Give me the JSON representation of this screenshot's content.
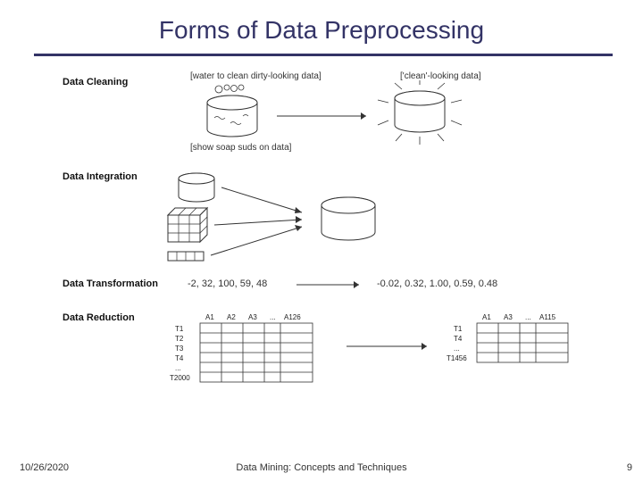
{
  "title": "Forms of Data Preprocessing",
  "sections": {
    "cleaning": "Data Cleaning",
    "integration": "Data Integration",
    "transformation": "Data Transformation",
    "reduction": "Data Reduction"
  },
  "captions": {
    "dirty": "[water to clean dirty-looking data]",
    "clean": "['clean'-looking data]",
    "suds": "[show soap suds on data]"
  },
  "transformation": {
    "input": "-2, 32, 100, 59, 48",
    "output": "-0.02, 0.32, 1.00, 0.59, 0.48"
  },
  "reduction": {
    "left_cols": [
      "A1",
      "A2",
      "A3",
      "...",
      "A126"
    ],
    "left_rows": [
      "T1",
      "T2",
      "T3",
      "T4",
      "...",
      "T2000"
    ],
    "right_cols": [
      "A1",
      "A3",
      "...",
      "A115"
    ],
    "right_rows": [
      "T1",
      "T4",
      "...",
      "T1456"
    ]
  },
  "footer": {
    "date": "10/26/2020",
    "center": "Data Mining: Concepts and Techniques",
    "page": "9"
  }
}
